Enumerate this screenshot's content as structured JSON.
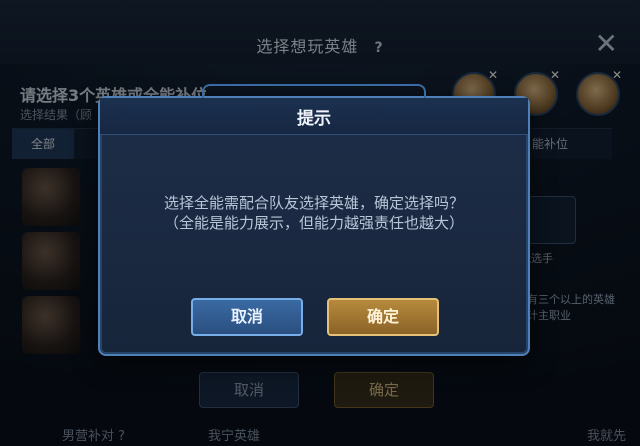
{
  "header": {
    "title": "选择想玩英雄",
    "help": "?",
    "close": "✕"
  },
  "subheader": {
    "title": "请选择3个英雄或全能补位",
    "result": "选择结果（顾"
  },
  "tabs": {
    "all": "全部",
    "right": "能补位"
  },
  "side": {
    "slot_label": "能选手",
    "note": "拥有三个以上的英雄 统计主职业"
  },
  "background_buttons": {
    "cancel": "取消",
    "confirm": "确定"
  },
  "bottom": {
    "left": "男营补对 ?",
    "mid": "我宁英雄",
    "right": "我就先"
  },
  "dialog": {
    "title": "提示",
    "message_line1": "选择全能需配合队友选择英雄，确定选择吗？",
    "message_line2": "（全能是能力展示，但能力越强责任也越大）",
    "cancel_label": "取消",
    "confirm_label": "确定"
  },
  "icons": {
    "close": "close-icon",
    "help": "help-icon"
  },
  "colors": {
    "accent_blue": "#4f80b7",
    "confirm_gold": "#b68a3c"
  }
}
